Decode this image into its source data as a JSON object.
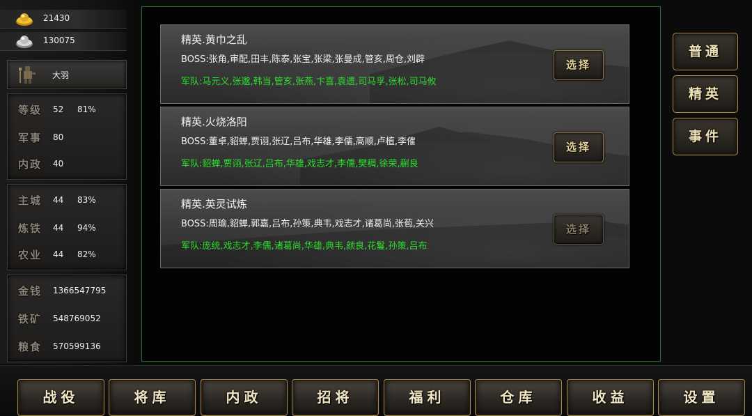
{
  "resources": {
    "gold": {
      "icon": "gold-ingot-icon",
      "value": "21430"
    },
    "silver": {
      "icon": "silver-ingot-icon",
      "value": "130075"
    }
  },
  "profile": {
    "name": "大羽",
    "icon": "soldier-avatar-icon"
  },
  "stats": {
    "level": {
      "label": "等级",
      "value": "52",
      "percent": "81%"
    },
    "military": {
      "label": "军事",
      "value": "80"
    },
    "politics": {
      "label": "内政",
      "value": "40"
    }
  },
  "buildings": {
    "main_city": {
      "label": "主城",
      "value": "44",
      "percent": "83%"
    },
    "smelting": {
      "label": "炼铁",
      "value": "44",
      "percent": "94%"
    },
    "farming": {
      "label": "农业",
      "value": "44",
      "percent": "82%"
    }
  },
  "assets": {
    "money": {
      "label": "金钱",
      "value": "1366547795"
    },
    "iron": {
      "label": "铁矿",
      "value": "548769052"
    },
    "grain": {
      "label": "粮食",
      "value": "570599136"
    }
  },
  "campaigns": [
    {
      "title": "精英.黄巾之乱",
      "boss": "BOSS:张角,审配,田丰,陈泰,张宝,张梁,张曼成,管亥,周仓,刘辟",
      "army": "军队:马元义,张邈,韩当,管亥,张燕,卞喜,袁遗,司马孚,张松,司马攸",
      "button": "选择",
      "enabled": true
    },
    {
      "title": "精英.火烧洛阳",
      "boss": "BOSS:董卓,貂蝉,贾诩,张辽,吕布,华雄,李儒,高顺,卢植,李傕",
      "army": "军队:貂蝉,贾诩,张辽,吕布,华雄,戏志才,李儒,樊稠,徐荣,蒯良",
      "button": "选择",
      "enabled": true
    },
    {
      "title": "精英.英灵试炼",
      "boss": "BOSS:周瑜,貂蝉,郭嘉,吕布,孙策,典韦,戏志才,诸葛尚,张苞,关兴",
      "army": "军队:庞统,戏志才,李儒,诸葛尚,华雄,典韦,颜良,花鬘,孙策,吕布",
      "button": "选择",
      "enabled": false
    }
  ],
  "categories": [
    "普通",
    "精英",
    "事件"
  ],
  "nav": [
    "战役",
    "将库",
    "内政",
    "招将",
    "福利",
    "仓库",
    "收益",
    "设置"
  ],
  "colors": {
    "army_text": "#2ede2e",
    "frame_green": "#2e6b2e",
    "button_gold": "#b08e4c"
  }
}
